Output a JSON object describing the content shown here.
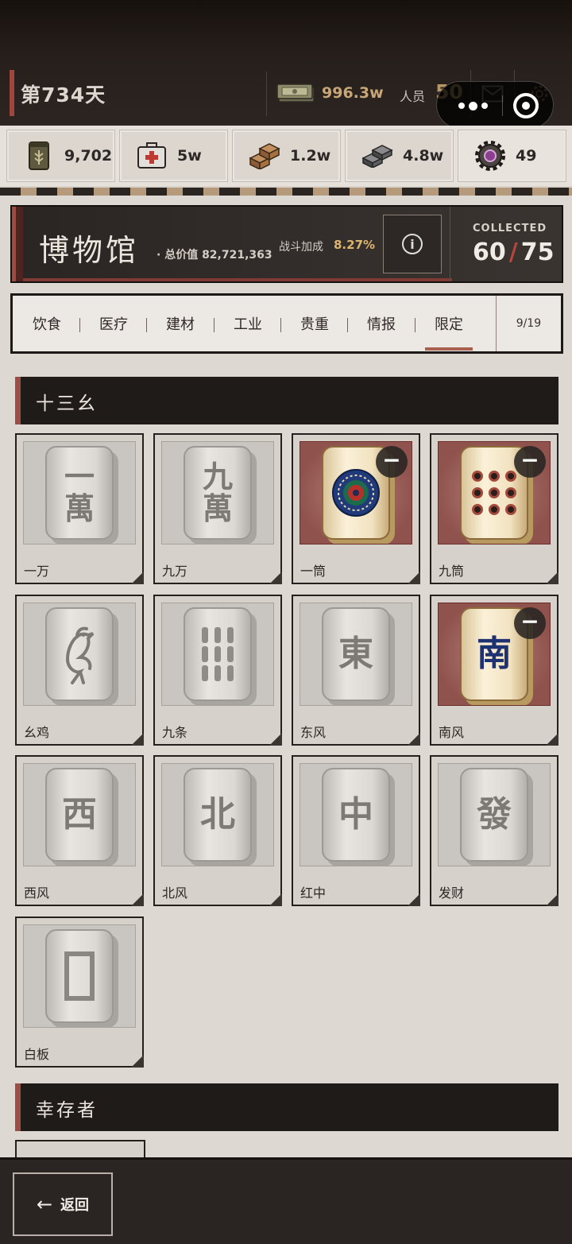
{
  "topbar": {
    "day": "第734天",
    "cash": "996.3w",
    "cash_icon": "cash-stack-icon",
    "staff_label": "人员",
    "staff_value": "50"
  },
  "resources": [
    {
      "icon": "grain-sack-icon",
      "value": "9,702"
    },
    {
      "icon": "medkit-icon",
      "value": "5w"
    },
    {
      "icon": "bricks-icon",
      "value": "1.2w"
    },
    {
      "icon": "steel-ingot-icon",
      "value": "4.8w"
    },
    {
      "icon": "gear-component-icon",
      "value": "49"
    }
  ],
  "museum": {
    "title": "博物馆",
    "total_value": "· 总价值 82,721,363",
    "bonus_label": "战斗加成",
    "bonus_value": "8.27%",
    "info": "i",
    "collected_label": "COLLECTED",
    "collected": "60",
    "total": "75",
    "slash": "/"
  },
  "tabs": {
    "items": [
      "饮食",
      "医疗",
      "建材",
      "工业",
      "贵重",
      "情报",
      "限定"
    ],
    "active": "限定",
    "count": "9/19"
  },
  "sections": {
    "first": "十三幺",
    "second": "幸存者"
  },
  "cards": [
    {
      "name": "一万",
      "owned": false,
      "glyph": "一\n萬"
    },
    {
      "name": "九万",
      "owned": false,
      "glyph": "九\n萬"
    },
    {
      "name": "一筒",
      "owned": true,
      "glyph": ""
    },
    {
      "name": "九筒",
      "owned": true,
      "glyph": ""
    },
    {
      "name": "幺鸡",
      "owned": false,
      "glyph": ""
    },
    {
      "name": "九条",
      "owned": false,
      "glyph": ""
    },
    {
      "name": "东风",
      "owned": false,
      "glyph": "東"
    },
    {
      "name": "南风",
      "owned": true,
      "glyph": "南"
    },
    {
      "name": "西风",
      "owned": false,
      "glyph": "西"
    },
    {
      "name": "北风",
      "owned": false,
      "glyph": "北"
    },
    {
      "name": "红中",
      "owned": false,
      "glyph": "中"
    },
    {
      "name": "发财",
      "owned": false,
      "glyph": "發"
    },
    {
      "name": "白板",
      "owned": false,
      "glyph": ""
    }
  ],
  "minus_symbol": "−",
  "back": {
    "arrow": "←",
    "label": "返回"
  },
  "colors": {
    "accent_red": "#a0463d",
    "gold_text": "#c7a777",
    "bonus_gold": "#dcb56f",
    "owned_bg": "#8f524c"
  }
}
